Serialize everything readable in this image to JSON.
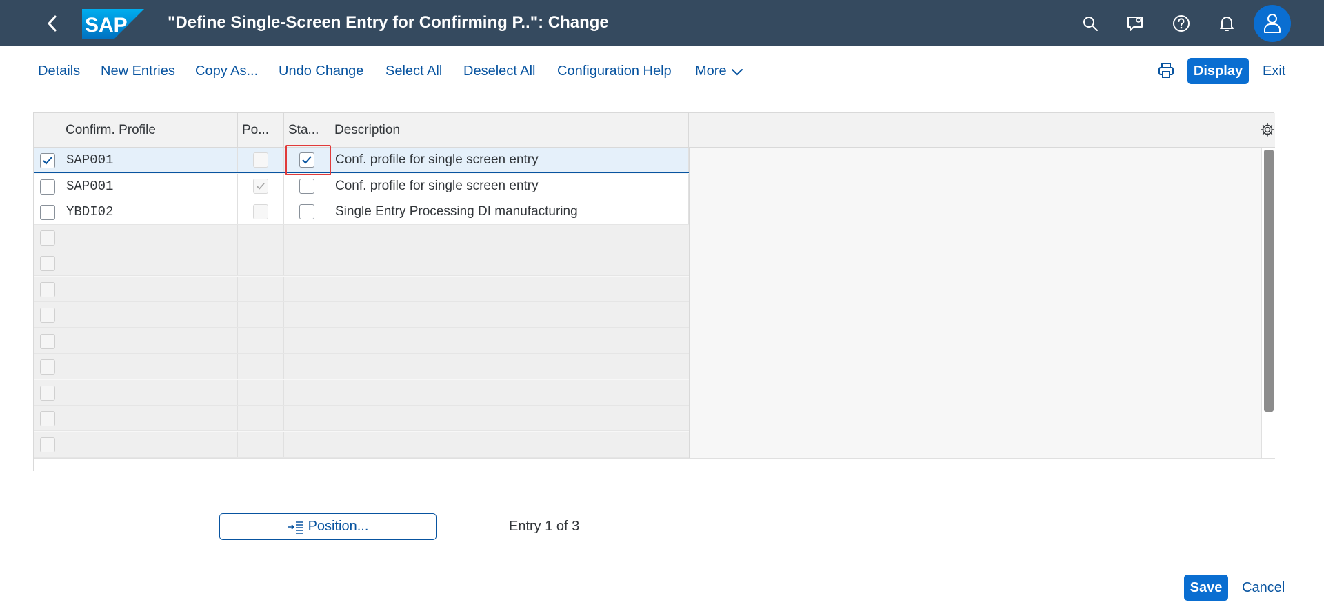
{
  "shell": {
    "title": "\"Define Single-Screen Entry for Confirming P..\": Change",
    "logo_text": "SAP",
    "icons": [
      "back-icon",
      "search-icon",
      "feedback-icon",
      "help-icon",
      "notification-bell-icon",
      "user-icon"
    ]
  },
  "toolbar": {
    "details": "Details",
    "new_entries": "New Entries",
    "copy_as": "Copy As...",
    "undo_change": "Undo Change",
    "select_all": "Select All",
    "deselect_all": "Deselect All",
    "configuration_help": "Configuration Help",
    "more": "More",
    "display": "Display",
    "exit": "Exit"
  },
  "table": {
    "columns": [
      "Confirm. Profile",
      "Po...",
      "Sta...",
      "Description"
    ],
    "rows": [
      {
        "profile": "SAP001",
        "po": false,
        "sta": true,
        "description": "Conf. profile for single screen entry",
        "selected": true
      },
      {
        "profile": "SAP001",
        "po": true,
        "sta": false,
        "description": "Conf. profile for single screen entry",
        "selected": false
      },
      {
        "profile": "YBDI02",
        "po": false,
        "sta": false,
        "description": "Single Entry Processing DI manufacturing",
        "selected": false
      }
    ]
  },
  "bottom": {
    "position_button": "Position...",
    "entry_status": "Entry 1 of 3"
  },
  "footer": {
    "save": "Save",
    "cancel": "Cancel"
  },
  "colors": {
    "shell_bg": "#354a5f",
    "accent": "#0a6ed1",
    "link": "#0854a0",
    "highlight": "#e03a3a"
  }
}
